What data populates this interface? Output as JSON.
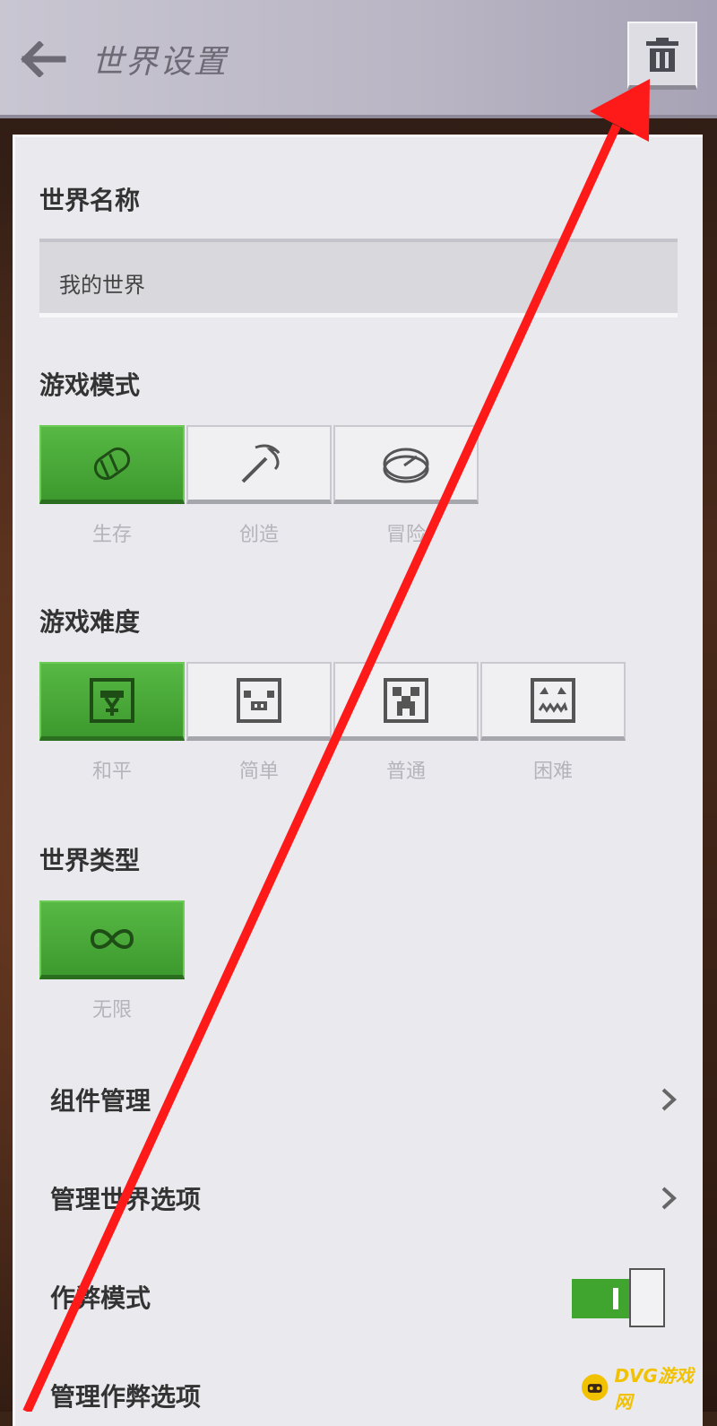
{
  "header": {
    "title": "世界设置",
    "back_icon": "arrow-left-icon",
    "delete_icon": "trash-icon"
  },
  "world_name": {
    "label": "世界名称",
    "value": "我的世界"
  },
  "game_mode": {
    "label": "游戏模式",
    "options": [
      {
        "label": "生存",
        "icon": "bread-icon",
        "selected": true
      },
      {
        "label": "创造",
        "icon": "pickaxe-icon",
        "selected": false
      },
      {
        "label": "冒险",
        "icon": "compass-icon",
        "selected": false
      }
    ]
  },
  "difficulty": {
    "label": "游戏难度",
    "options": [
      {
        "label": "和平",
        "icon": "peaceful-icon",
        "selected": true
      },
      {
        "label": "简单",
        "icon": "pig-icon",
        "selected": false
      },
      {
        "label": "普通",
        "icon": "creeper-icon",
        "selected": false
      },
      {
        "label": "困难",
        "icon": "ghast-icon",
        "selected": false
      }
    ]
  },
  "world_type": {
    "label": "世界类型",
    "options": [
      {
        "label": "无限",
        "icon": "infinity-icon",
        "selected": true
      }
    ]
  },
  "rows": {
    "addons": "组件管理",
    "world_options": "管理世界选项",
    "cheats": "作弊模式",
    "cheat_options": "管理作弊选项"
  },
  "cheats_toggle": {
    "on": true
  },
  "watermark": {
    "text": "DVG游戏网"
  },
  "colors": {
    "selected_green": "#3d9a2e",
    "annotation_arrow": "#ff1a1a",
    "watermark_yellow": "#f2c200"
  }
}
